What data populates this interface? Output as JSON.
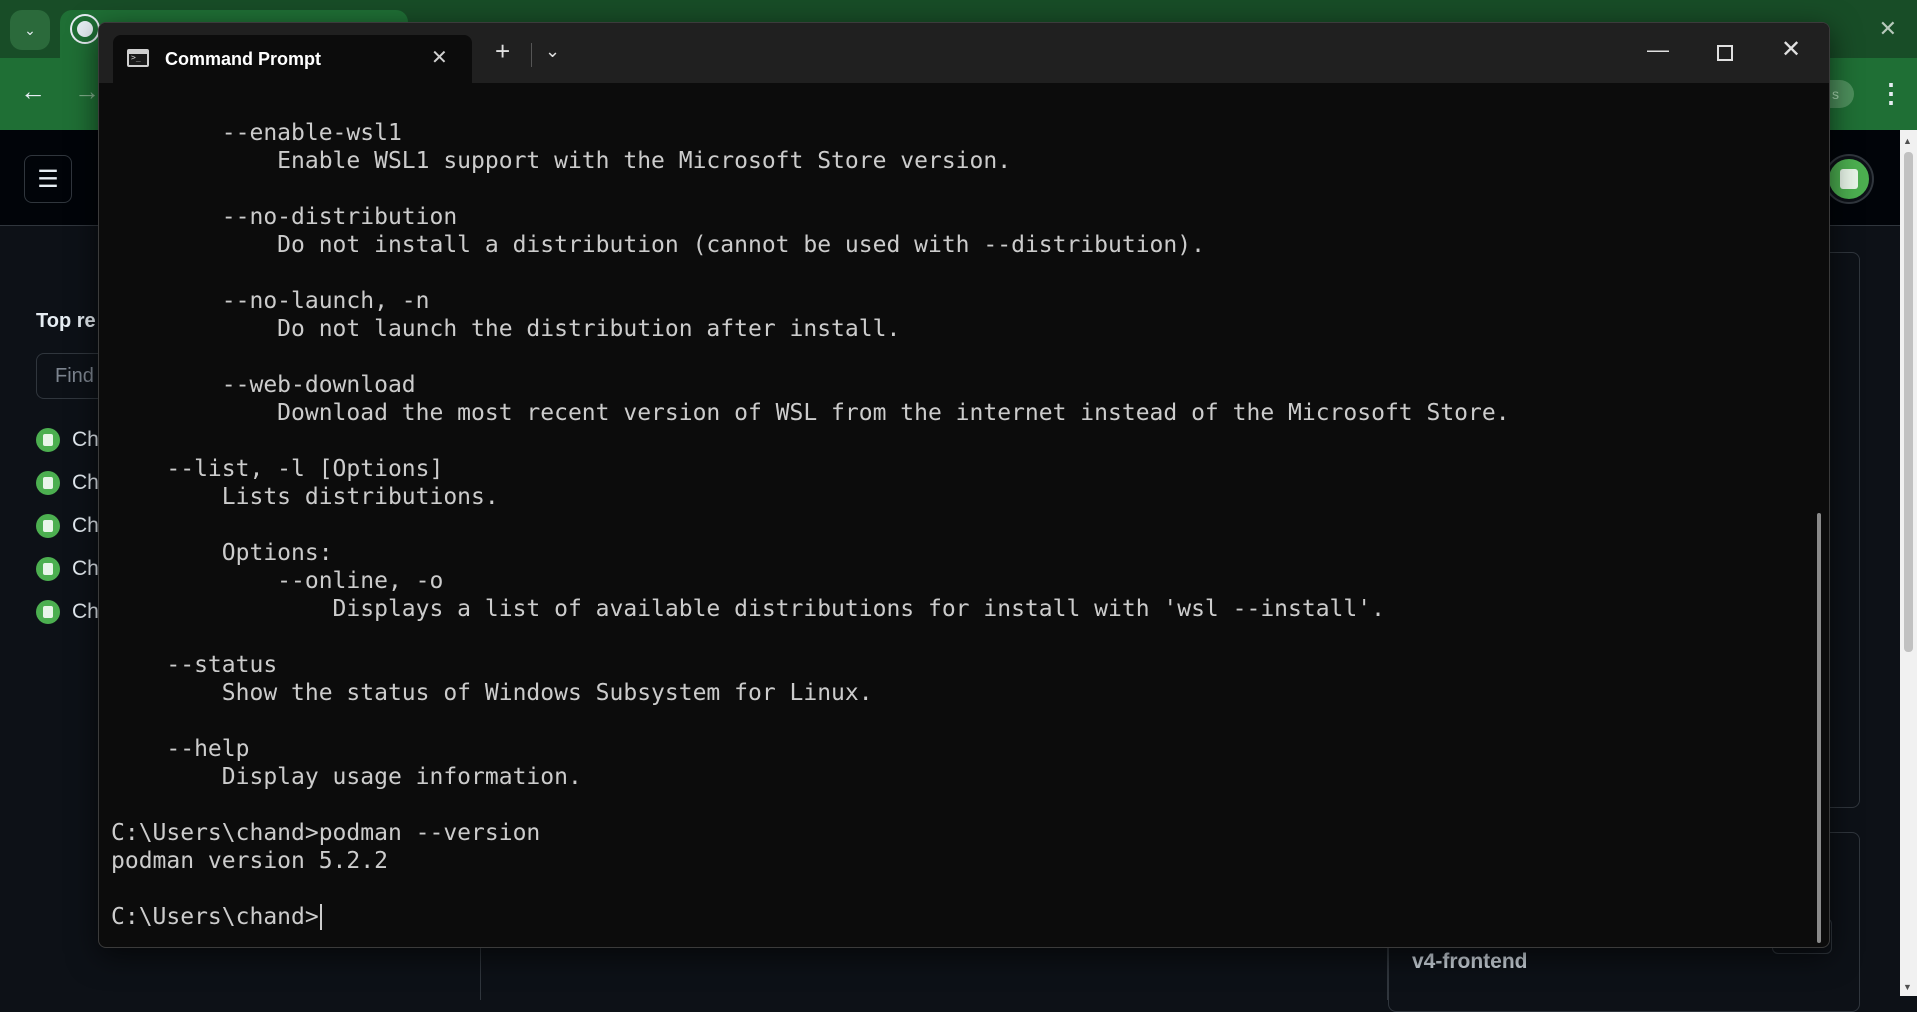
{
  "browser": {
    "tab_search_icon": "chevron-down-icon",
    "github_tab_icon": "github-icon",
    "close_icon": "close-icon",
    "ext_text": "s"
  },
  "github": {
    "sidebar_title": "Top re",
    "find_placeholder": "Find",
    "repos": [
      "Ch",
      "Ch",
      "Ch",
      "Ch",
      "Ch"
    ],
    "repo_link": "v4-frontend"
  },
  "terminal": {
    "tab_title": "Command Prompt",
    "lines": [
      "        --enable-wsl1",
      "            Enable WSL1 support with the Microsoft Store version.",
      "",
      "        --no-distribution",
      "            Do not install a distribution (cannot be used with --distribution).",
      "",
      "        --no-launch, -n",
      "            Do not launch the distribution after install.",
      "",
      "        --web-download",
      "            Download the most recent version of WSL from the internet instead of the Microsoft Store.",
      "",
      "    --list, -l [Options]",
      "        Lists distributions.",
      "",
      "        Options:",
      "            --online, -o",
      "                Displays a list of available distributions for install with 'wsl --install'.",
      "",
      "    --status",
      "        Show the status of Windows Subsystem for Linux.",
      "",
      "    --help",
      "        Display usage information.",
      "",
      "C:\\Users\\chand>podman --version",
      "podman version 5.2.2",
      "",
      "C:\\Users\\chand>"
    ]
  }
}
